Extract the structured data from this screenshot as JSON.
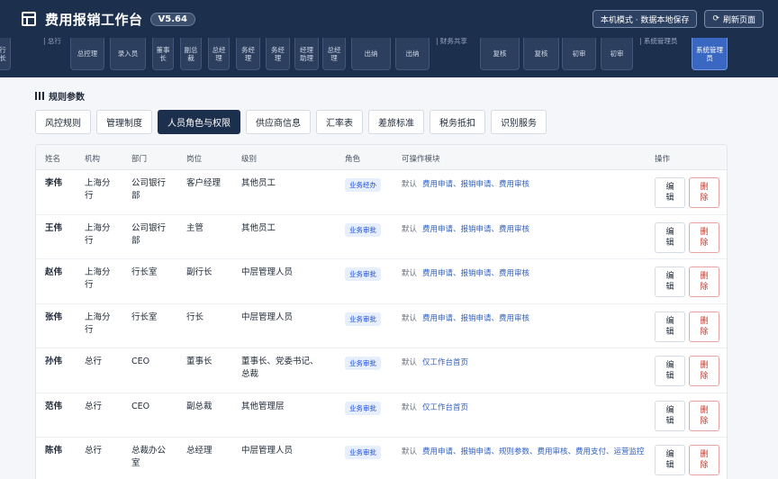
{
  "header": {
    "title": "费用报销工作台",
    "version": "V5.64",
    "mode_button": "本机模式 · 数据本地保存",
    "refresh_button": "刷新页面"
  },
  "role_strip": {
    "left_fragment": "行长",
    "groups": [
      "总行",
      "财务共享",
      "系统管理员"
    ],
    "chips": [
      "总控理",
      "录入员",
      "董事长",
      "副总裁",
      "总经理",
      "务经理",
      "务经理",
      "经理助理",
      "总经理",
      "出纳",
      "出纳",
      "复核",
      "复核",
      "初审",
      "初审",
      "系统管理员"
    ]
  },
  "section": {
    "title": "规则参数"
  },
  "tabs": [
    "风控规则",
    "管理制度",
    "人员角色与权限",
    "供应商信息",
    "汇率表",
    "差旅标准",
    "税务抵扣",
    "识别服务"
  ],
  "active_tab": "人员角色与权限",
  "table": {
    "headers": [
      "姓名",
      "机构",
      "部门",
      "岗位",
      "级别",
      "角色",
      "可操作模块",
      "操作"
    ],
    "default_label": "默认",
    "edit_label": "编辑",
    "delete_label": "删除",
    "rows": [
      {
        "name": "李伟",
        "org": "上海分行",
        "dept": "公司银行部",
        "post": "客户经理",
        "level": "其他员工",
        "role": "业务经办",
        "modules": "费用申请、报销申请、费用审核"
      },
      {
        "name": "王伟",
        "org": "上海分行",
        "dept": "公司银行部",
        "post": "主管",
        "level": "其他员工",
        "role": "业务审批",
        "modules": "费用申请、报销申请、费用审核"
      },
      {
        "name": "赵伟",
        "org": "上海分行",
        "dept": "行长室",
        "post": "副行长",
        "level": "中层管理人员",
        "role": "业务审批",
        "modules": "费用申请、报销申请、费用审核"
      },
      {
        "name": "张伟",
        "org": "上海分行",
        "dept": "行长室",
        "post": "行长",
        "level": "中层管理人员",
        "role": "业务审批",
        "modules": "费用申请、报销申请、费用审核"
      },
      {
        "name": "孙伟",
        "org": "总行",
        "dept": "CEO",
        "post": "董事长",
        "level": "董事长、党委书记、总裁",
        "role": "业务审批",
        "modules": "仅工作台首页"
      },
      {
        "name": "范伟",
        "org": "总行",
        "dept": "CEO",
        "post": "副总裁",
        "level": "其他管理层",
        "role": "业务审批",
        "modules": "仅工作台首页"
      },
      {
        "name": "陈伟",
        "org": "总行",
        "dept": "总裁办公室",
        "post": "总经理",
        "level": "中层管理人员",
        "role": "业务审批",
        "modules": "费用申请、报销申请、规则参数、费用审核、费用支付、运营监控"
      }
    ]
  },
  "colors": {
    "header_bg": "#1c2f4d",
    "accent": "#3a67c2",
    "link": "#2f5fbf",
    "delete": "#c0392b"
  }
}
